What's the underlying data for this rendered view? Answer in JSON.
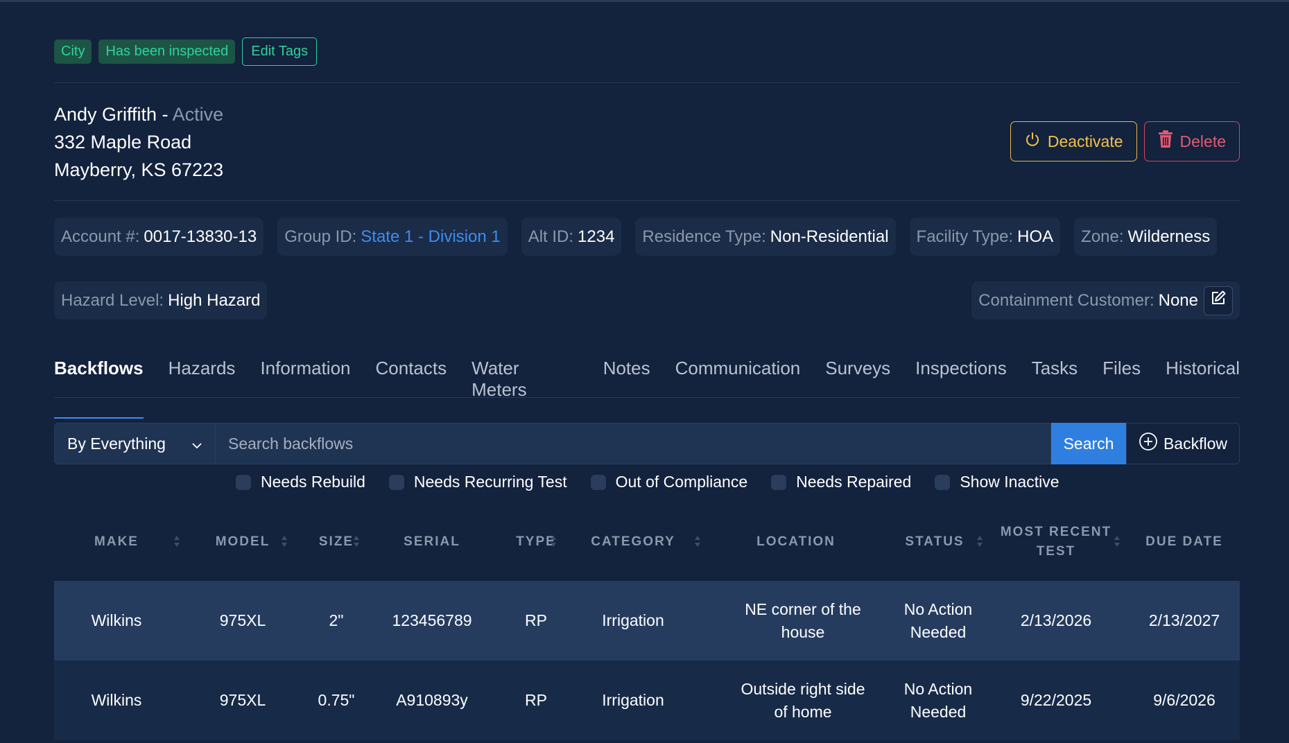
{
  "tags": [
    "City",
    "Has been inspected"
  ],
  "edit_tags_label": "Edit Tags",
  "customer": {
    "name": "Andy Griffith",
    "separator": " - ",
    "status": "Active",
    "address_line1": "332 Maple Road",
    "address_line2": "Mayberry, KS 67223"
  },
  "actions": {
    "deactivate": "Deactivate",
    "delete": "Delete"
  },
  "info": {
    "account": {
      "label": "Account #:",
      "value": "0017-13830-13"
    },
    "group": {
      "label": "Group ID:",
      "value": "State 1 - Division 1"
    },
    "alt": {
      "label": "Alt ID:",
      "value": "1234"
    },
    "residence": {
      "label": "Residence Type:",
      "value": "Non-Residential"
    },
    "facility": {
      "label": "Facility Type:",
      "value": "HOA"
    },
    "zone": {
      "label": "Zone:",
      "value": "Wilderness"
    },
    "hazard": {
      "label": "Hazard Level:",
      "value": "High Hazard"
    },
    "containment": {
      "label": "Containment Customer:",
      "value": "None"
    }
  },
  "tabs": [
    "Backflows",
    "Hazards",
    "Information",
    "Contacts",
    "Water Meters",
    "Notes",
    "Communication",
    "Surveys",
    "Inspections",
    "Tasks",
    "Files",
    "Historical"
  ],
  "search": {
    "filter_selected": "By Everything",
    "placeholder": "Search backflows",
    "button": "Search",
    "add_button": "Backflow"
  },
  "filters": [
    "Needs Rebuild",
    "Needs Recurring Test",
    "Out of Compliance",
    "Needs Repaired",
    "Show Inactive"
  ],
  "table": {
    "headers": [
      "MAKE",
      "MODEL",
      "SIZE",
      "SERIAL",
      "TYPE",
      "CATEGORY",
      "LOCATION",
      "STATUS",
      "MOST RECENT TEST",
      "DUE DATE"
    ],
    "rows": [
      [
        "Wilkins",
        "975XL",
        "2\"",
        "123456789",
        "RP",
        "Irrigation",
        "NE corner of the house",
        "No Action Needed",
        "2/13/2026",
        "2/13/2027"
      ],
      [
        "Wilkins",
        "975XL",
        "0.75\"",
        "A910893y",
        "RP",
        "Irrigation",
        "Outside right side of home",
        "No Action Needed",
        "9/22/2025",
        "9/6/2026"
      ]
    ]
  },
  "colors": {
    "background": "#13223d",
    "accent": "#2f7fe0",
    "tag_text": "#2fd39b",
    "warning": "#f2c24d",
    "danger": "#e35a72"
  }
}
